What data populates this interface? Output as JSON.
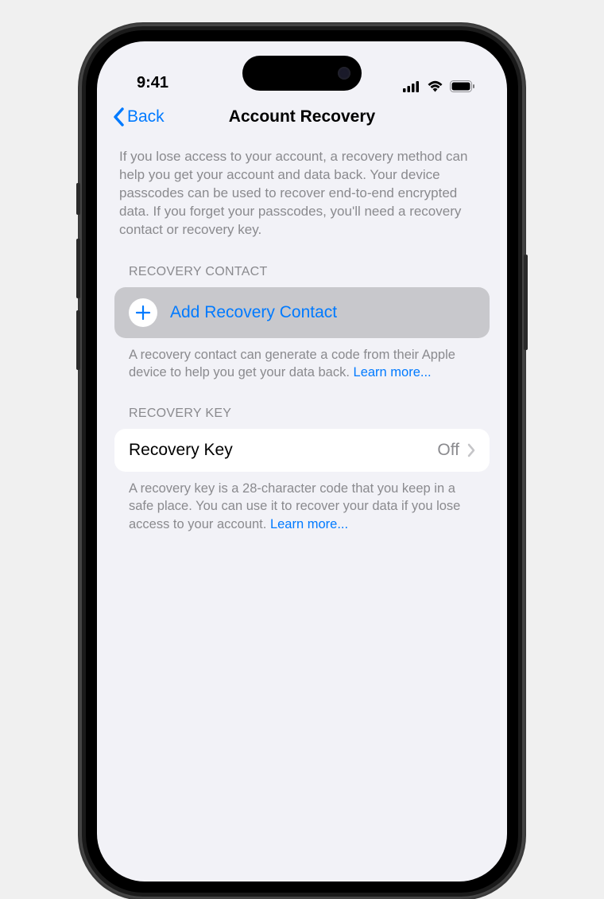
{
  "status": {
    "time": "9:41"
  },
  "nav": {
    "back_label": "Back",
    "title": "Account Recovery"
  },
  "intro": "If you lose access to your account, a recovery method can help you get your account and data back. Your device passcodes can be used to recover end-to-end encrypted data. If you forget your passcodes, you'll need a recovery contact or recovery key.",
  "sections": {
    "recovery_contact": {
      "header": "RECOVERY CONTACT",
      "add_label": "Add Recovery Contact",
      "footer_text": "A recovery contact can generate a code from their Apple device to help you get your data back. ",
      "learn_more": "Learn more..."
    },
    "recovery_key": {
      "header": "RECOVERY KEY",
      "label": "Recovery Key",
      "value": "Off",
      "footer_text": "A recovery key is a 28-character code that you keep in a safe place. You can use it to recover your data if you lose access to your account. ",
      "learn_more": "Learn more..."
    }
  }
}
